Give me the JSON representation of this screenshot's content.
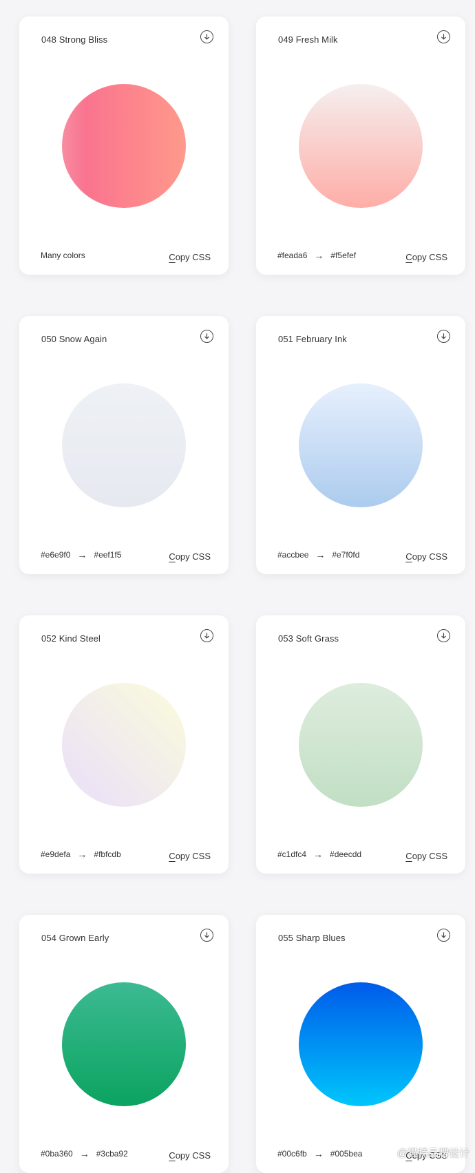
{
  "cards": [
    {
      "title": "048 Strong Bliss",
      "desc": "Many colors",
      "from": "",
      "to": "",
      "arrow": "",
      "copy_label": "Copy CSS",
      "gradient": "linear-gradient(to right, #f78ca0 0%, #f9748f 19%, #fd868c 60%, #fe9a8b 100%)"
    },
    {
      "title": "049 Fresh Milk",
      "desc": "",
      "from": "#feada6",
      "to": "#f5efef",
      "arrow": "→",
      "copy_label": "Copy CSS",
      "gradient": "linear-gradient(to top, #feada6 0%, #f5efef 100%)"
    },
    {
      "title": "050 Snow Again",
      "desc": "",
      "from": "#e6e9f0",
      "to": "#eef1f5",
      "arrow": "→",
      "copy_label": "Copy CSS",
      "gradient": "linear-gradient(to top, #e6e9f0 0%, #eef1f5 100%)"
    },
    {
      "title": "051 February Ink",
      "desc": "",
      "from": "#accbee",
      "to": "#e7f0fd",
      "arrow": "→",
      "copy_label": "Copy CSS",
      "gradient": "linear-gradient(to top, #accbee 0%, #e7f0fd 100%)"
    },
    {
      "title": "052 Kind Steel",
      "desc": "",
      "from": "#e9defa",
      "to": "#fbfcdb",
      "arrow": "→",
      "copy_label": "Copy CSS",
      "gradient": "linear-gradient(to top right, #e9defa 0%, #fbfcdb 100%)"
    },
    {
      "title": "053 Soft Grass",
      "desc": "",
      "from": "#c1dfc4",
      "to": "#deecdd",
      "arrow": "→",
      "copy_label": "Copy CSS",
      "gradient": "linear-gradient(to top, #c1dfc4 0%, #deecdd 100%)"
    },
    {
      "title": "054 Grown Early",
      "desc": "",
      "from": "#0ba360",
      "to": "#3cba92",
      "arrow": "→",
      "copy_label": "Copy CSS",
      "gradient": "linear-gradient(to top, #0ba360 0%, #3cba92 100%)"
    },
    {
      "title": "055 Sharp Blues",
      "desc": "",
      "from": "#00c6fb",
      "to": "#005bea",
      "arrow": "→",
      "copy_label": "Copy CSS",
      "gradient": "linear-gradient(to top, #00c6fb 0%, #005bea 100%)"
    }
  ],
  "icons": {
    "download": "download-circle-icon",
    "arrow": "right-arrow-icon",
    "weibo": "weibo-icon"
  },
  "watermark": {
    "text": "@猫特品牌设计"
  },
  "colors": {
    "background": "#f5f5f7",
    "card": "#ffffff",
    "text": "#333333"
  }
}
